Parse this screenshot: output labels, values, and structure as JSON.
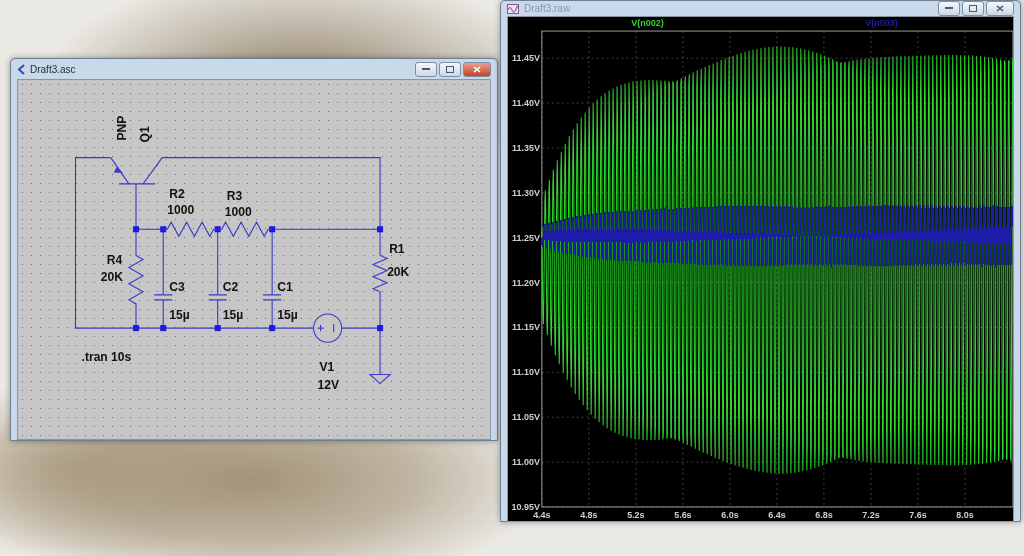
{
  "schematic_window": {
    "title": "Draft3.asc",
    "components": [
      {
        "kind": "transistor",
        "name": "Q1",
        "value": "PNP"
      },
      {
        "kind": "resistor",
        "name": "R2",
        "value": "1000"
      },
      {
        "kind": "resistor",
        "name": "R3",
        "value": "1000"
      },
      {
        "kind": "resistor",
        "name": "R4",
        "value": "20K"
      },
      {
        "kind": "resistor",
        "name": "R1",
        "value": "20K"
      },
      {
        "kind": "capacitor",
        "name": "C3",
        "value": "15µ"
      },
      {
        "kind": "capacitor",
        "name": "C2",
        "value": "15µ"
      },
      {
        "kind": "capacitor",
        "name": "C1",
        "value": "15µ"
      },
      {
        "kind": "source",
        "name": "V1",
        "value": "12V"
      }
    ],
    "directive": ".tran 10s"
  },
  "plot_window": {
    "title": "Draft3.raw",
    "traces": [
      {
        "name": "V(n002)",
        "color": "#2ed62e"
      },
      {
        "name": "V(n003)",
        "color": "#1c1ca8"
      }
    ],
    "y_ticks": [
      "11.45V",
      "11.40V",
      "11.35V",
      "11.30V",
      "11.25V",
      "11.20V",
      "11.15V",
      "11.10V",
      "11.05V",
      "11.00V",
      "10.95V"
    ],
    "x_ticks": [
      "4.4s",
      "4.8s",
      "5.2s",
      "5.6s",
      "6.0s",
      "6.4s",
      "6.8s",
      "7.2s",
      "7.6s",
      "8.0s"
    ]
  }
}
